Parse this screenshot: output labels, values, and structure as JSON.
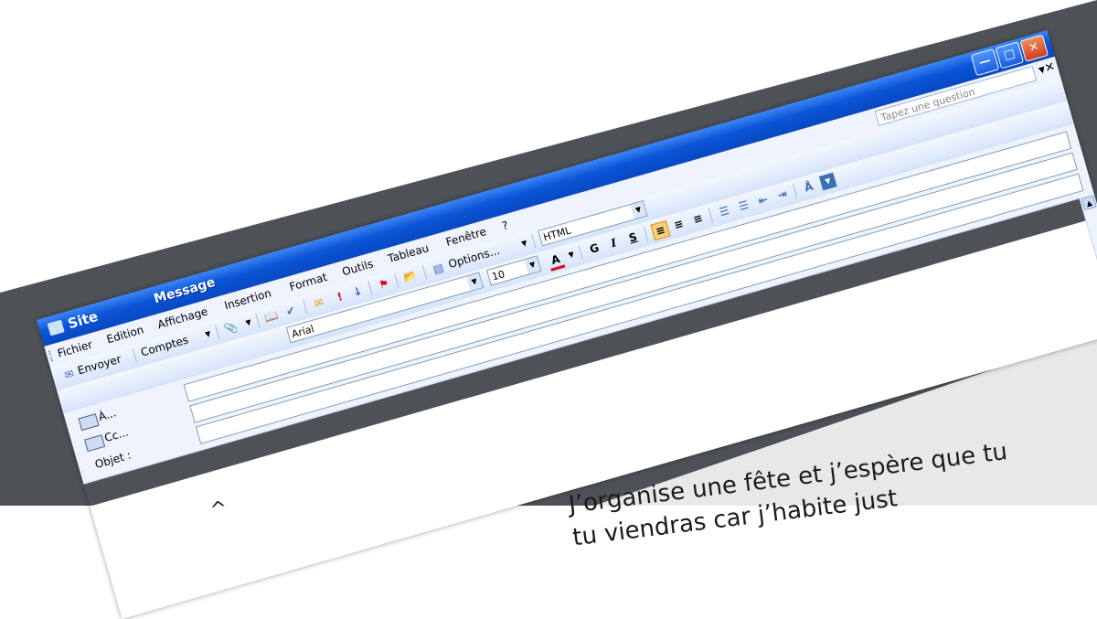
{
  "window": {
    "app_name": "Site",
    "title": "Message",
    "colors": {
      "titlebar": "#0a55d8",
      "chrome": "#eef3fd",
      "page_bg": "#4e5256"
    }
  },
  "menu": {
    "items": [
      "Fichier",
      "Edition",
      "Affichage",
      "Insertion",
      "Format",
      "Outils",
      "Tableau",
      "Fenêtre",
      "?"
    ],
    "help_placeholder": "Tapez une question"
  },
  "toolbar1": {
    "send_label": "Envoyer",
    "accounts_label": "Comptes",
    "options_label": "Options...",
    "format_value": "HTML"
  },
  "header": {
    "to_label": "À...",
    "cc_label": "Cc...",
    "subject_label": "Objet :"
  },
  "format_toolbar": {
    "font_value": "Arial",
    "size_value": "10",
    "bold": "G",
    "italic": "I",
    "underline": "S"
  },
  "body": {
    "lines": [
      "J’organise une fête et j’espère que tu",
      "tu viendras car j’habite just"
    ],
    "accent": "^"
  }
}
